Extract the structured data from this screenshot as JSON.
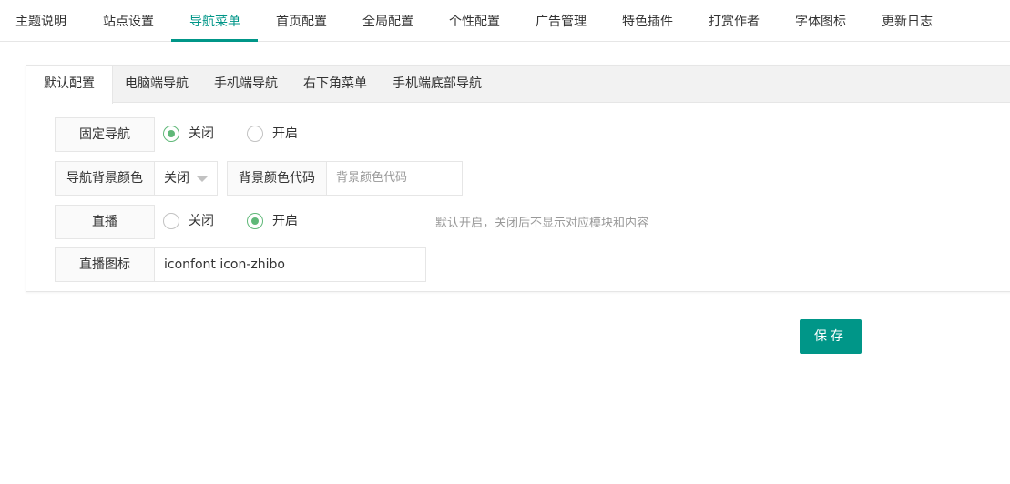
{
  "top_tabs": [
    {
      "label": "主题说明"
    },
    {
      "label": "站点设置"
    },
    {
      "label": "导航菜单"
    },
    {
      "label": "首页配置"
    },
    {
      "label": "全局配置"
    },
    {
      "label": "个性配置"
    },
    {
      "label": "广告管理"
    },
    {
      "label": "特色插件"
    },
    {
      "label": "打赏作者"
    },
    {
      "label": "字体图标"
    },
    {
      "label": "更新日志"
    }
  ],
  "sub_tabs": [
    {
      "label": "默认配置"
    },
    {
      "label": "电脑端导航"
    },
    {
      "label": "手机端导航"
    },
    {
      "label": "右下角菜单"
    },
    {
      "label": "手机端底部导航"
    }
  ],
  "form": {
    "fixed_nav": {
      "label": "固定导航",
      "options": [
        {
          "label": "关闭",
          "checked": true
        },
        {
          "label": "开启",
          "checked": false
        }
      ]
    },
    "nav_bg_color": {
      "label": "导航背景颜色",
      "selected": "关闭",
      "code_label": "背景颜色代码",
      "code_placeholder": "背景颜色代码"
    },
    "live": {
      "label": "直播",
      "options": [
        {
          "label": "关闭",
          "checked": false
        },
        {
          "label": "开启",
          "checked": true
        }
      ],
      "hint": "默认开启，关闭后不显示对应模块和内容"
    },
    "live_icon": {
      "label": "直播图标",
      "value": "iconfont icon-zhibo"
    }
  },
  "save_label": "保存",
  "colors": {
    "accent": "#009688",
    "radio_checked": "#5FB878"
  }
}
